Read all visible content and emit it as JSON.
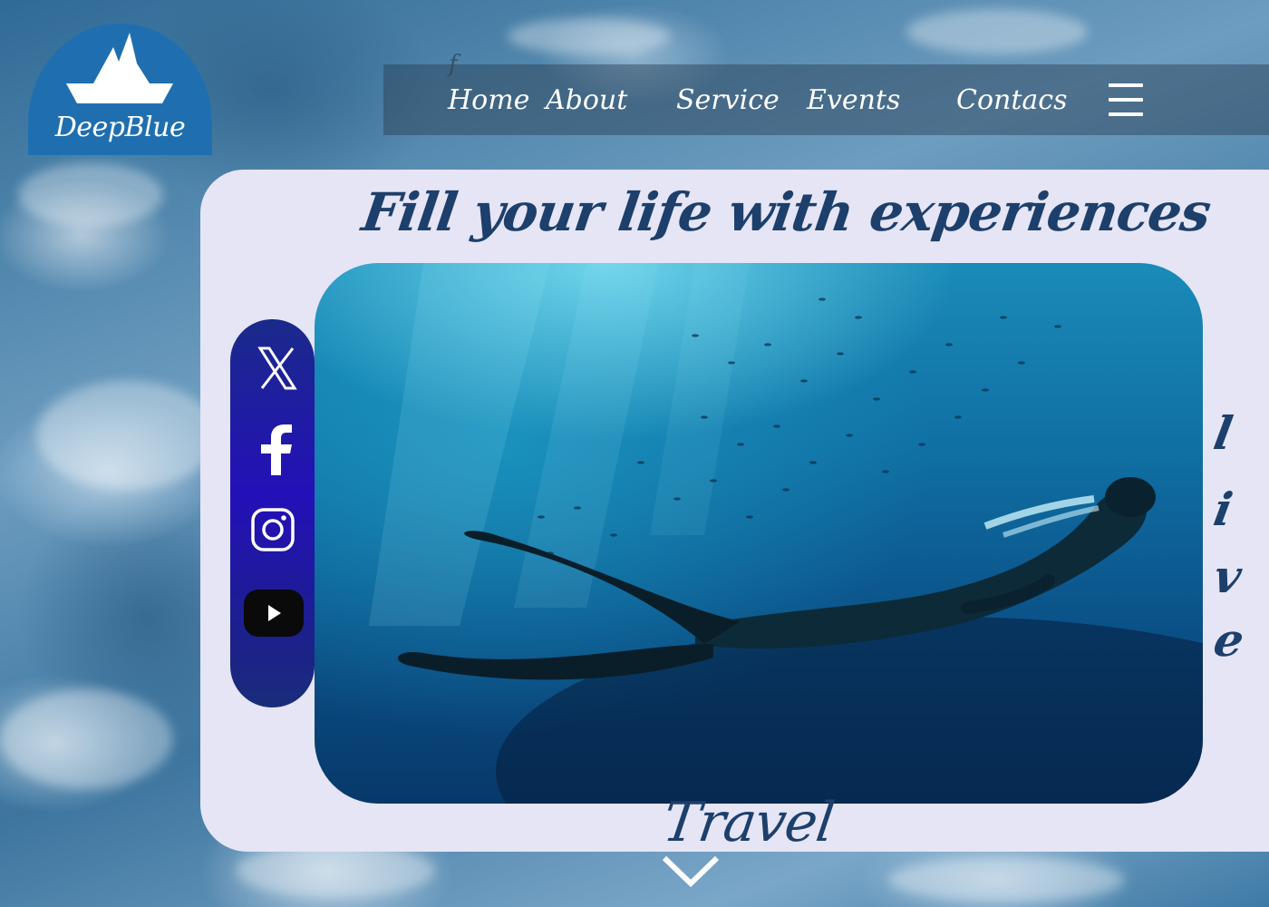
{
  "brand": {
    "name": "DeepBlue",
    "logo_color": "#1f6fb0"
  },
  "nav": {
    "stray_glyph": "f",
    "items": [
      {
        "label": "Home"
      },
      {
        "label": "About"
      },
      {
        "label": "Service"
      },
      {
        "label": "Events"
      },
      {
        "label": "Contacs"
      }
    ],
    "menu_icon": "hamburger-menu-icon"
  },
  "hero": {
    "headline": "Fill your life with experiences",
    "image": "freediver-with-monofin-underwater",
    "side_word_letters": [
      "l",
      "i",
      "v",
      "e"
    ],
    "bottom_word": "Travel",
    "scroll_icon": "chevron-down-icon"
  },
  "social": [
    {
      "icon": "x-icon"
    },
    {
      "icon": "facebook-icon"
    },
    {
      "icon": "instagram-icon"
    },
    {
      "icon": "youtube-icon"
    }
  ],
  "colors": {
    "card": "#e6e5f5",
    "text_dark_blue": "#1d3f6b",
    "social_bar": "#2410b8"
  }
}
